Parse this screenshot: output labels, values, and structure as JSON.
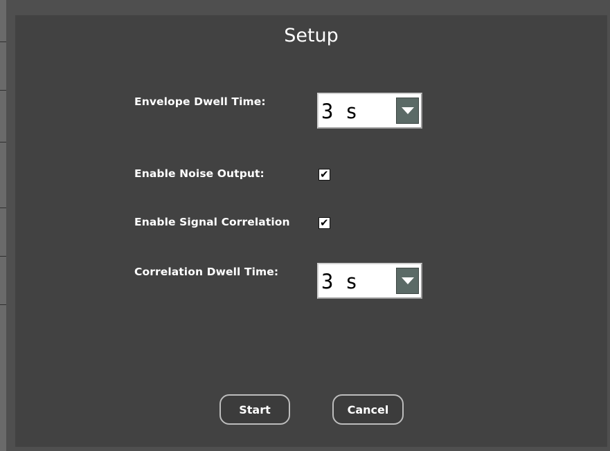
{
  "dialog": {
    "title": "Setup"
  },
  "envelope_dwell": {
    "label": "Envelope Dwell Time:",
    "value": "3 s"
  },
  "noise_output": {
    "label": "Enable Noise Output:",
    "checked": true,
    "check_glyph": "✔"
  },
  "signal_correlation": {
    "label": "Enable Signal Correlation",
    "checked": true,
    "check_glyph": "✔"
  },
  "correlation_dwell": {
    "label": "Correlation Dwell Time:",
    "value": "3 s"
  },
  "buttons": {
    "start_label": "Start",
    "cancel_label": "Cancel"
  },
  "icons": {
    "dropdown_arrow": "chevron-down-icon",
    "checkmark": "checkmark-icon"
  },
  "colors": {
    "background": "#4f4f4f",
    "panel": "#424242",
    "dropdown_button": "#5b6a66",
    "text": "#ffffff"
  }
}
